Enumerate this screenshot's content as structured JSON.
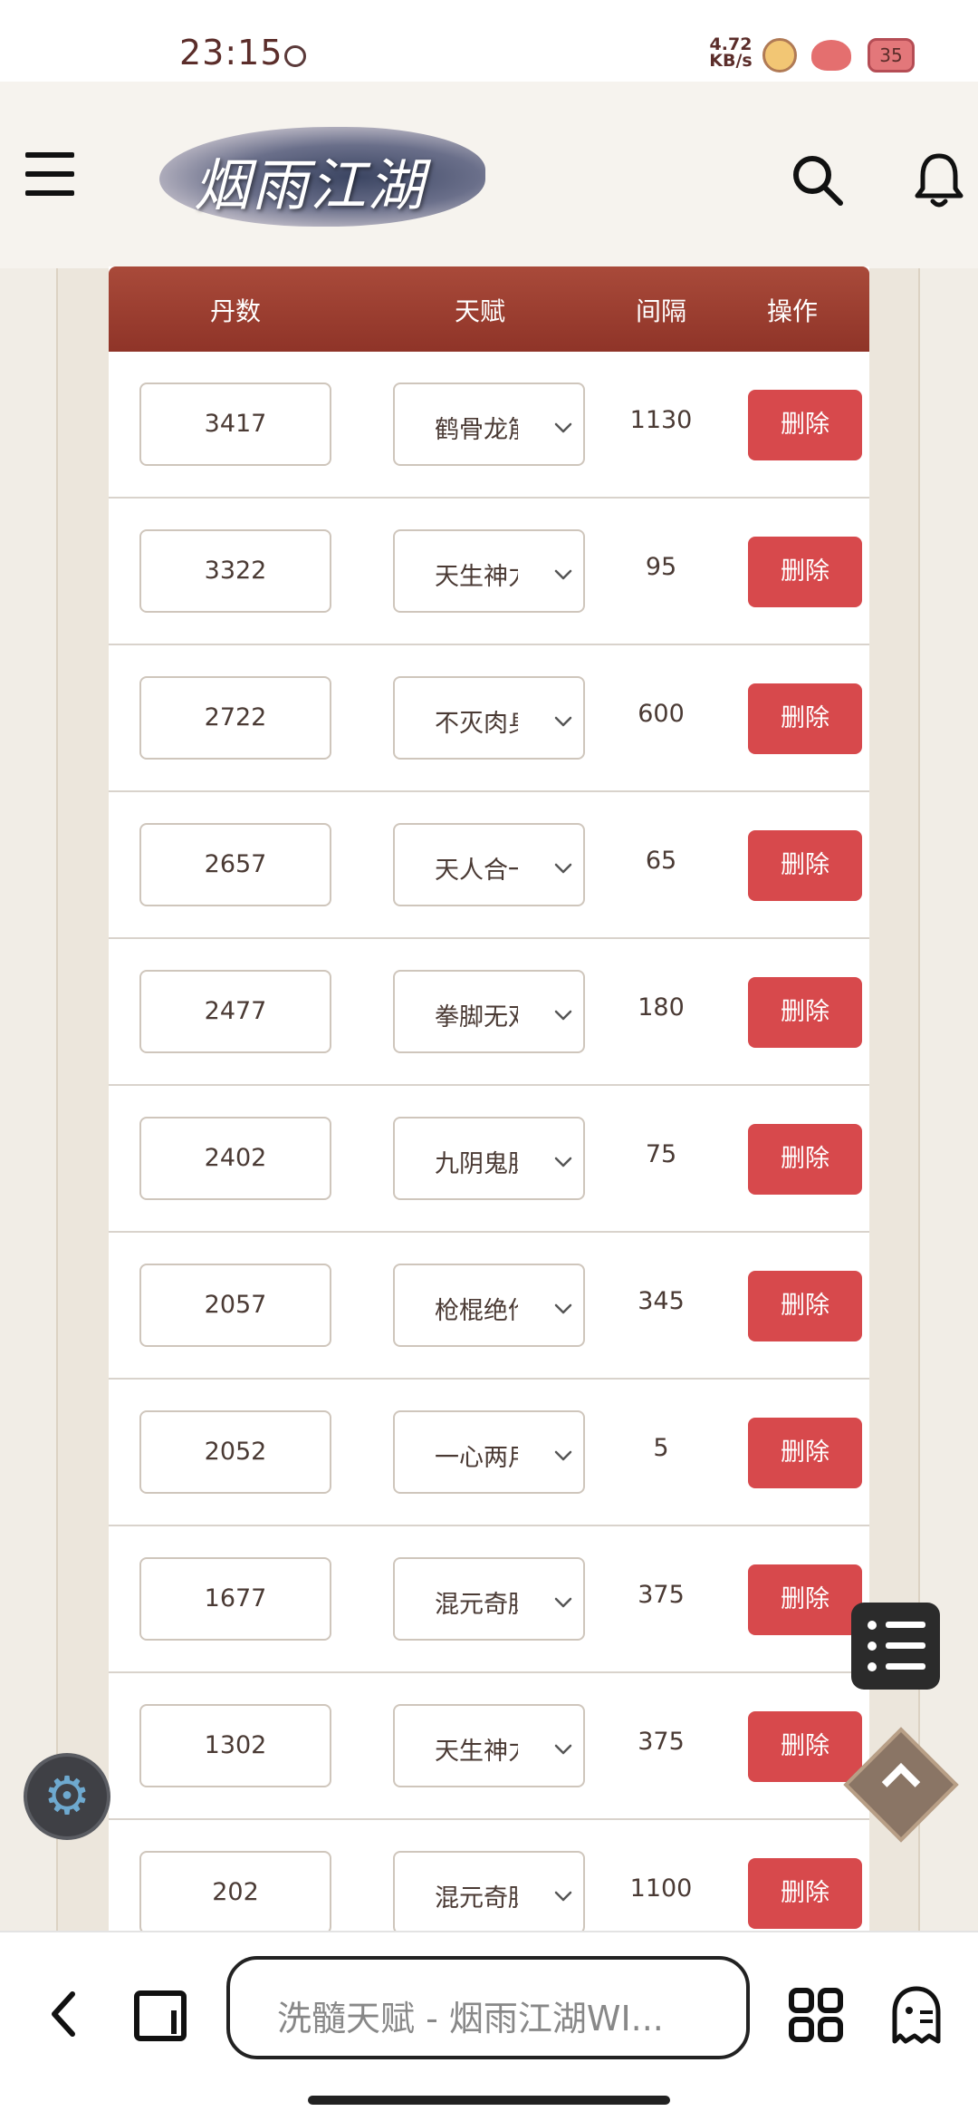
{
  "status_bar": {
    "time": "23:15",
    "net_speed_value": "4.72",
    "net_speed_unit": "KB/s",
    "battery_level": "35"
  },
  "header": {
    "logo_text": "烟雨江湖"
  },
  "table": {
    "columns": [
      "丹数",
      "天赋",
      "间隔",
      "操作"
    ],
    "delete_label": "删除",
    "rows": [
      {
        "count": "3417",
        "talent": "鹤骨龙筋",
        "interval": "1130"
      },
      {
        "count": "3322",
        "talent": "天生神力",
        "interval": "95"
      },
      {
        "count": "2722",
        "talent": "不灭肉身",
        "interval": "600"
      },
      {
        "count": "2657",
        "talent": "天人合一",
        "interval": "65"
      },
      {
        "count": "2477",
        "talent": "拳脚无双",
        "interval": "180"
      },
      {
        "count": "2402",
        "talent": "九阴鬼脉",
        "interval": "75"
      },
      {
        "count": "2057",
        "talent": "枪棍绝伦",
        "interval": "345"
      },
      {
        "count": "2052",
        "talent": "一心两用",
        "interval": "5"
      },
      {
        "count": "1677",
        "talent": "混元奇脉",
        "interval": "375"
      },
      {
        "count": "1302",
        "talent": "天生神力",
        "interval": "375"
      },
      {
        "count": "202",
        "talent": "混元奇脉",
        "interval": "1100"
      }
    ]
  },
  "browser": {
    "url_title": "洗髓天赋 - 烟雨江湖WI..."
  },
  "colors": {
    "header_bg": "#9c3e30",
    "delete_button": "#d7494c",
    "page_bg": "#f1ede6"
  }
}
